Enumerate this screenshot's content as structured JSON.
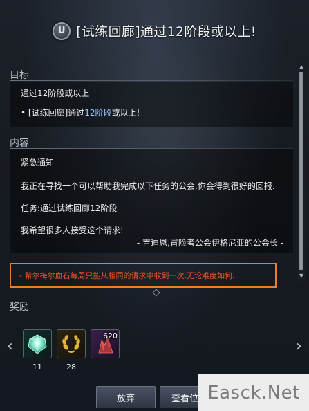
{
  "title": "[试练回廊]通过12阶段或以上!",
  "emblem_icon": "shield-u-icon",
  "objective": {
    "label": "目标",
    "main": "通过12阶段或以上",
    "sub_bullet": "•",
    "sub_prefix": "[试练回廊]通过",
    "sub_highlight": "12阶段",
    "sub_suffix": "或以上!"
  },
  "content": {
    "label": "内容",
    "heading": "紧急通知",
    "line1": "我正在寻找一个可以帮助我完成以下任务的公会.你会得到很好的回报.",
    "line2": "任务:通过试练回廊12阶段",
    "line3": "我希望很多人接受这个请求!",
    "signature": "- 吉迪恩,冒险者公会伊格尼亚的公会长 -"
  },
  "notice": "- 希尔梅尔血石每周只能从相同的请求中收到一次,无论难度如何.",
  "rewards": {
    "label": "奖励",
    "items": [
      {
        "icon": "gem-icon",
        "count": "11"
      },
      {
        "icon": "laurel-wreath-icon",
        "count": "28"
      },
      {
        "icon": "bloodstone-icon",
        "stack": "620"
      }
    ]
  },
  "buttons": {
    "abandon": "放弃",
    "view": "查看位"
  },
  "watermark": "Easck.Net",
  "colors": {
    "notice_border": "#e8802a",
    "notice_text": "#e5542a",
    "highlight": "#9ec7ff"
  }
}
